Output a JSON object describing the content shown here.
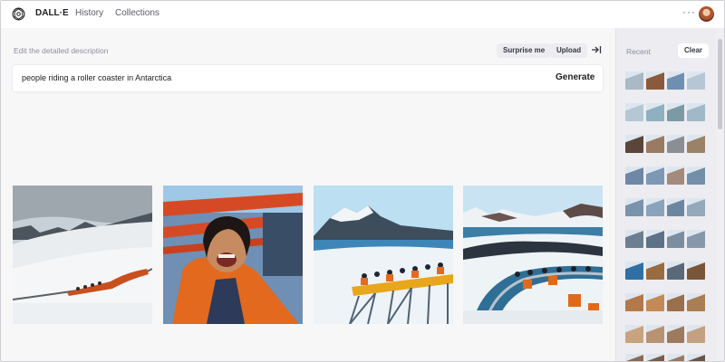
{
  "app": {
    "brand": "DALL·E",
    "nav": [
      "History",
      "Collections"
    ],
    "more_label": "···",
    "icons": [
      "openai-logo-icon",
      "more-icon",
      "collapse-panel-icon"
    ]
  },
  "prompt": {
    "label": "Edit the detailed description",
    "surprise_label": "Surprise me",
    "upload_label": "Upload",
    "value": "people riding a roller coaster in Antarctica",
    "generate_label": "Generate"
  },
  "results": [
    {
      "subject": "coaster-on-snowy-slope"
    },
    {
      "subject": "laughing-rider-closeup"
    },
    {
      "subject": "riders-on-bridge-with-mountains"
    },
    {
      "subject": "riders-on-curving-coaster"
    }
  ],
  "sidebar": {
    "title": "Recent",
    "clear_label": "Clear",
    "thumb_rows": [
      [
        "#a9b9c6",
        "#8b5a3c",
        "#6f8fb2",
        "#b7c6d4"
      ],
      [
        "#b4c7d4",
        "#8fb0c0",
        "#7c9aa6",
        "#a0b8c8"
      ],
      [
        "#5a4638",
        "#9a7a63",
        "#8b8f93",
        "#9a8266"
      ],
      [
        "#6f87a6",
        "#7d98b4",
        "#a38a7a",
        "#738fa8"
      ],
      [
        "#7a93ad",
        "#8aa3ba",
        "#6d86a0",
        "#94a8bb"
      ],
      [
        "#6c7f92",
        "#5d7288",
        "#7b8ea1",
        "#8698aa"
      ],
      [
        "#2f6fa3",
        "#9a6b3f",
        "#5a6978",
        "#7a5638"
      ],
      [
        "#b3794b",
        "#c48a55",
        "#9a6f4c",
        "#a97e53"
      ],
      [
        "#c9a27e",
        "#b89372",
        "#9c7a5e",
        "#c3a181"
      ],
      [
        "#8a6a52",
        "#7a5d48",
        "#9a7a60",
        "#6d5444"
      ]
    ]
  },
  "colors": {
    "background": "#f7f7f8",
    "sidebar": "#ececf1",
    "text": "#202123",
    "muted": "#8e8ea0"
  }
}
